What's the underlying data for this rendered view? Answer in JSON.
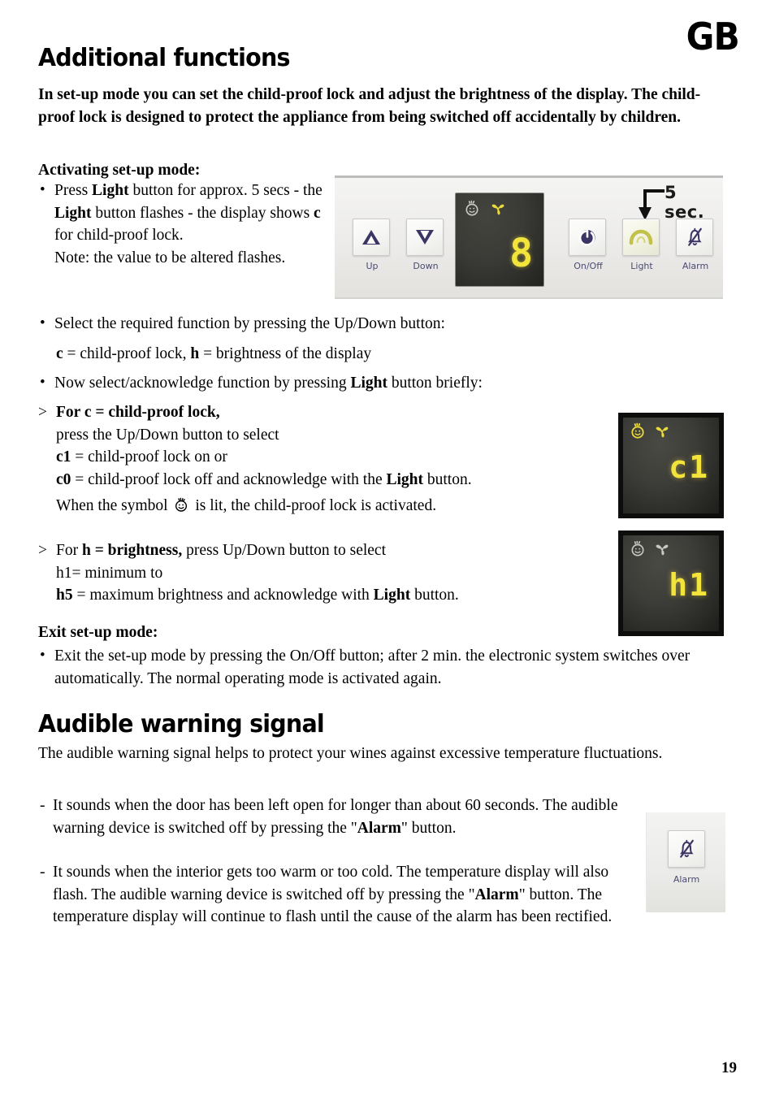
{
  "page": {
    "locale_badge": "GB",
    "page_number": "19"
  },
  "section1": {
    "title": "Additional functions",
    "intro": "In set-up mode you can set the child-proof lock  and adjust the brightness of the display. The child-proof lock is designed to protect the appliance from being switched off accidentally by children.",
    "activating_head": "Activating set-up mode:",
    "bullet_press_light": "Press Light button for approx. 5 secs - the Light button flashes - the display shows c for child-proof lock.",
    "note_line": "Note: the value to be altered flashes.",
    "bullet_select_function": "Select the required function by pressing the Up/Down button:",
    "function_legend": "c = child-proof lock, h = brightness of the display",
    "bullet_acknowledge": "Now select/acknowledge function by pressing Light button briefly:",
    "child_lock_head": "For c = child-proof lock,",
    "child_lock_l1": "press the Up/Down button to select",
    "child_lock_l2": "c1 = child-proof lock on or",
    "child_lock_l3": "c0 = child-proof lock off and acknowledge with the Light button.",
    "child_lock_l4_pre": "When the symbol",
    "child_lock_l4_post": "is lit, the child-proof lock is activated.",
    "brightness_head": "For h = brightness, press Up/Down button to select",
    "brightness_l1": "h1= minimum to",
    "brightness_l2": "h5 = maximum brightness and acknowledge with Light button.",
    "exit_head": "Exit set-up mode:",
    "exit_bullet": "Exit the set-up mode by pressing the On/Off button; after 2 min. the electronic system switches over automatically. The normal operating mode is activated again."
  },
  "section2": {
    "title": "Audible warning signal",
    "intro": "The audible warning signal helps to protect your wines against excessive temperature fluctuations.",
    "item1": "It sounds when the door has been left open for longer than about 60 seconds. The audible warning device is switched off by pressing the \"Alarm\" button.",
    "item2": "It sounds when the interior gets too warm or too cold. The temperature display will also flash. The audible warning device is switched off by pressing the \"Alarm\" button. The temperature display will continue to flash until the cause of the alarm has been rectified."
  },
  "control_panel": {
    "annotation": "5 sec.",
    "buttons": [
      {
        "label": "Up",
        "icon": "triangle-up-icon",
        "state": "normal"
      },
      {
        "label": "Down",
        "icon": "triangle-down-icon",
        "state": "normal"
      },
      {
        "label": "On/Off",
        "icon": "power-icon",
        "state": "normal"
      },
      {
        "label": "Light",
        "icon": "lamp-icon",
        "state": "lit"
      },
      {
        "label": "Alarm",
        "icon": "bell-crossed-icon",
        "state": "normal"
      }
    ],
    "display": {
      "value": "8",
      "child_lock_icon": "child-face-icon",
      "child_lock_lit": false,
      "fan_icon": "fan-icon",
      "fan_lit": true
    }
  },
  "lcd_child_lock": {
    "value": "c1",
    "child_lock_icon": "child-face-icon",
    "child_lock_lit": true,
    "fan_icon": "fan-icon",
    "fan_lit": true
  },
  "lcd_brightness": {
    "value": "h1",
    "child_lock_icon": "child-face-icon",
    "child_lock_lit": false,
    "fan_icon": "fan-icon",
    "fan_lit": false
  },
  "alarm_card": {
    "label": "Alarm",
    "icon": "bell-crossed-icon"
  },
  "colors": {
    "lcd_yellow": "#f3e43c",
    "lcd_background": "#3a3a36",
    "button_label_blue": "#4a4a72",
    "light_button_olive": "#c9c94a"
  }
}
